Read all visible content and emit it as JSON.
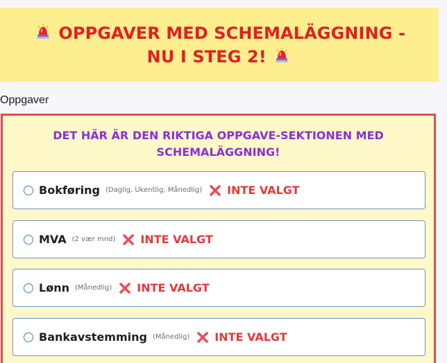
{
  "banner": {
    "line1": "OPPGAVER MED SCHEMALÄGGNING -",
    "line2": "NU I STEG 2!",
    "left_icon": "siren-icon",
    "right_icon": "siren-icon",
    "background_color": "#fdee8f",
    "text_color": "#e02121"
  },
  "section": {
    "label": "Oppgaver"
  },
  "panel": {
    "heading_line1": "DET HÄR ÄR DEN RIKTIGA OPPGAVE-SEKTIONEN MED",
    "heading_line2": "SCHEMALÄGGNING!",
    "border_color": "#e24a4a",
    "background_color": "#fff8c8",
    "heading_color": "#8a2fd8"
  },
  "tasks": [
    {
      "name": "Bokføring",
      "frequency": "(Daglig, Ukentlig, Månedlig)",
      "status": "INTE VALGT",
      "status_icon": "cross-icon",
      "selected": false
    },
    {
      "name": "MVA",
      "frequency": "(2 vær mnd)",
      "status": "INTE VALGT",
      "status_icon": "cross-icon",
      "selected": false
    },
    {
      "name": "Lønn",
      "frequency": "(Månedlig)",
      "status": "INTE VALGT",
      "status_icon": "cross-icon",
      "selected": false
    },
    {
      "name": "Bankavstemming",
      "frequency": "(Månedlig)",
      "status": "INTE VALGT",
      "status_icon": "cross-icon",
      "selected": false
    }
  ]
}
